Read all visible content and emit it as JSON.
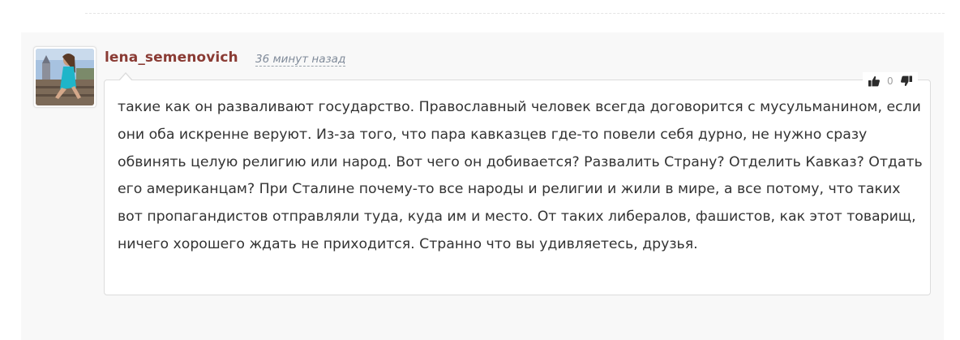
{
  "comment": {
    "author": "lena_semenovich",
    "time_ago": "36 минут назад",
    "vote_count": "0",
    "text": "такие как он разваливают государство. Православный человек всегда договорится с мусульманином, если они оба искренне веруют. Из-за того, что пара кавказцев где-то повели себя дурно, не нужно сразу обвинять целую религию или народ. Вот чего он добивается? Развалить Страну? Отделить Кавказ? Отдать его американцам? При Сталине почему-то все народы и религии и жили в мире, а все потому, что таких вот пропагандистов отправляли туда, куда им и место. От таких либералов, фашистов, как этот товарищ, ничего хорошего ждать не приходится. Странно что вы удивляетесь, друзья."
  },
  "icons": {
    "vote_up": "thumbs-up-icon",
    "vote_down": "thumbs-down-icon"
  },
  "colors": {
    "author_name": "#8a3b34",
    "timestamp": "#7f8a99",
    "panel_background": "#f8f8f8",
    "text": "#333333"
  }
}
